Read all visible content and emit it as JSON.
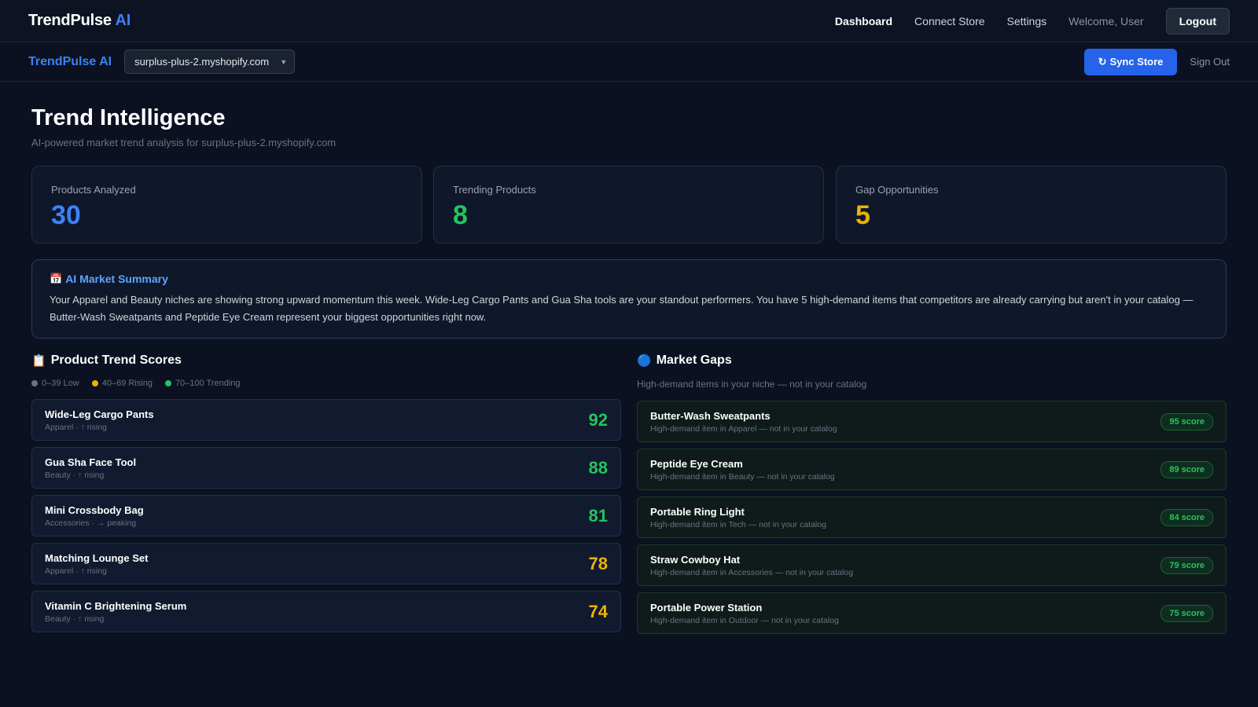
{
  "topbar": {
    "brand": "TrendPulse",
    "brand_ai": "AI",
    "nav": [
      {
        "label": "Dashboard",
        "active": true
      },
      {
        "label": "Connect Store",
        "active": false
      },
      {
        "label": "Settings",
        "active": false
      }
    ],
    "welcome": "Welcome, User",
    "logout_label": "Logout"
  },
  "subbar": {
    "brand": "TrendPulse AI",
    "store_value": "surplus-plus-2.myshopify.com",
    "sync_label": "Sync Store",
    "sync_icon": "↻",
    "signout_label": "Sign Out"
  },
  "page": {
    "title": "Trend Intelligence",
    "subtitle": "AI-powered market trend analysis for surplus-plus-2.myshopify.com"
  },
  "stats": [
    {
      "label": "Products Analyzed",
      "value": "30",
      "color": "#3b82f6"
    },
    {
      "label": "Trending Products",
      "value": "8",
      "color": "#22c55e"
    },
    {
      "label": "Gap Opportunities",
      "value": "5",
      "color": "#eab308"
    }
  ],
  "summary": {
    "icon": "calendar-icon",
    "title": "AI Market Summary",
    "text": "Your Apparel and Beauty niches are showing strong upward momentum this week. Wide-Leg Cargo Pants and Gua Sha tools are your standout performers. You have 5 high-demand items that competitors are already carrying but aren't in your catalog — Butter-Wash Sweatpants and Peptide Eye Cream represent your biggest opportunities right now."
  },
  "trends": {
    "icon": "clipboard-icon",
    "title": "Product Trend Scores",
    "legend": [
      {
        "label": "0–39 Low",
        "color": "#6b7280"
      },
      {
        "label": "40–69 Rising",
        "color": "#eab308"
      },
      {
        "label": "70–100 Trending",
        "color": "#22c55e"
      }
    ],
    "items": [
      {
        "name": "Wide-Leg Cargo Pants",
        "meta": "Apparel · ↑ rising",
        "score": "92",
        "color": "#22c55e"
      },
      {
        "name": "Gua Sha Face Tool",
        "meta": "Beauty · ↑ rising",
        "score": "88",
        "color": "#22c55e"
      },
      {
        "name": "Mini Crossbody Bag",
        "meta": "Accessories · → peaking",
        "score": "81",
        "color": "#22c55e"
      },
      {
        "name": "Matching Lounge Set",
        "meta": "Apparel · ↑ rising",
        "score": "78",
        "color": "#eab308"
      },
      {
        "name": "Vitamin C Brightening Serum",
        "meta": "Beauty · ↑ rising",
        "score": "74",
        "color": "#eab308"
      }
    ]
  },
  "gaps": {
    "icon": "blue-circle-icon",
    "title": "Market Gaps",
    "subtitle": "High-demand items in your niche — not in your catalog",
    "items": [
      {
        "name": "Butter-Wash Sweatpants",
        "meta": "High-demand item in Apparel — not in your catalog",
        "score": "95 score"
      },
      {
        "name": "Peptide Eye Cream",
        "meta": "High-demand item in Beauty — not in your catalog",
        "score": "89 score"
      },
      {
        "name": "Portable Ring Light",
        "meta": "High-demand item in Tech — not in your catalog",
        "score": "84 score"
      },
      {
        "name": "Straw Cowboy Hat",
        "meta": "High-demand item in Accessories — not in your catalog",
        "score": "79 score"
      },
      {
        "name": "Portable Power Station",
        "meta": "High-demand item in Outdoor — not in your catalog",
        "score": "75 score"
      }
    ]
  }
}
